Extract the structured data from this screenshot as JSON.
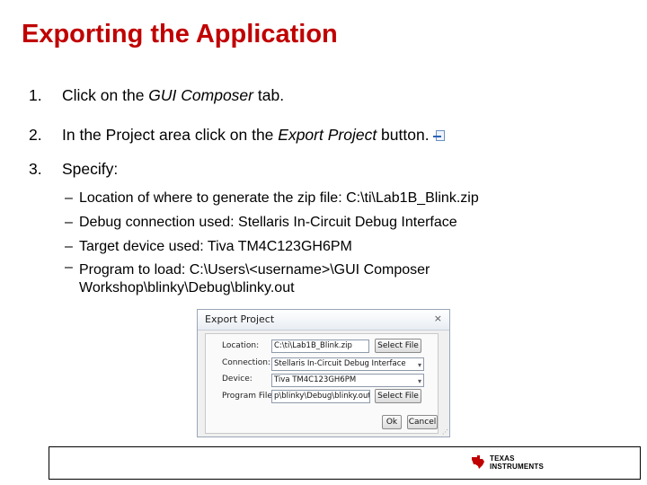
{
  "slide": {
    "title": "Exporting the Application",
    "steps": [
      {
        "num": "1.",
        "pre": "Click on the ",
        "em": "GUI Composer",
        "post": " tab."
      },
      {
        "num": "2.",
        "pre": "In the Project area click on the ",
        "em": "Export Project",
        "post": " button."
      },
      {
        "num": "3.",
        "pre": "Specify:",
        "em": "",
        "post": ""
      }
    ],
    "sub_items": [
      "Location of where to generate the zip file: C:\\ti\\Lab1B_Blink.zip",
      "Debug connection used: Stellaris In-Circuit Debug Interface",
      "Target device used: Tiva TM4C123GH6PM",
      "Program to load: C:\\Users\\<username>\\GUI Composer",
      "Workshop\\blinky\\Debug\\blinky.out"
    ],
    "dash": "–",
    "export_icon": "export-project-icon"
  },
  "dialog": {
    "title": "Export Project",
    "close": "×",
    "location_label": "Location:",
    "location_value": "C:\\ti\\Lab1B_Blink.zip",
    "connection_label": "Connection:",
    "connection_value": "Stellaris In-Circuit Debug Interface",
    "device_label": "Device:",
    "device_value": "Tiva TM4C123GH6PM",
    "program_label": "Program File:",
    "program_value": "p\\blinky\\Debug\\blinky.out",
    "select_file": "Select File",
    "ok": "Ok",
    "cancel": "Cancel",
    "chevron": "▾"
  },
  "footer": {
    "brand_line1": "TEXAS",
    "brand_line2": "INSTRUMENTS",
    "brand_color": "#c00000"
  }
}
